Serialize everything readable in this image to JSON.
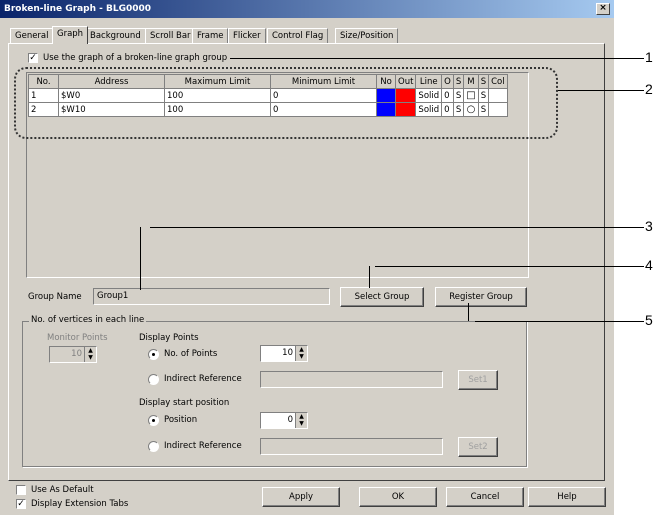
{
  "window": {
    "title": "Broken-line Graph - BLG0000",
    "close_glyph": "×"
  },
  "tabs": [
    {
      "label": "General"
    },
    {
      "label": "Graph"
    },
    {
      "label": "Background"
    },
    {
      "label": "Scroll Bar"
    },
    {
      "label": "Frame"
    },
    {
      "label": "Flicker"
    },
    {
      "label": "Control Flag"
    },
    {
      "label": "Size/Position"
    }
  ],
  "use_graph": {
    "label": "Use the graph of a broken-line graph group",
    "checked": true
  },
  "table": {
    "headers": [
      "No.",
      "Address",
      "Maximum Limit",
      "Minimum Limit",
      "No",
      "Out",
      "Line",
      "O",
      "S",
      "M",
      "S",
      "Col"
    ],
    "rows": [
      {
        "no": "1",
        "address": "$W0",
        "max": "100",
        "min": "0",
        "line": "Solid",
        "o": "0",
        "s": "S",
        "m": "□",
        "s2": "S",
        "normal_color": "#0000ff",
        "out_color": "#ff0000"
      },
      {
        "no": "2",
        "address": "$W10",
        "max": "100",
        "min": "0",
        "line": "Solid",
        "o": "0",
        "s": "S",
        "m": "○",
        "s2": "S",
        "normal_color": "#0000ff",
        "out_color": "#ff0000"
      }
    ]
  },
  "group_name": {
    "label": "Group Name",
    "value": "Group1"
  },
  "buttons": {
    "select_group": "Select Group",
    "register_group": "Register Group",
    "set1": "Set1",
    "set2": "Set2",
    "apply": "Apply",
    "ok": "OK",
    "cancel": "Cancel",
    "help": "Help"
  },
  "vertices": {
    "title": "No. of vertices in each line",
    "monitor_points_label": "Monitor Points",
    "monitor_points_value": "10",
    "display_points_label": "Display Points",
    "no_of_points_label": "No. of Points",
    "no_of_points_value": "10",
    "indirect_reference_label": "Indirect Reference",
    "display_start_label": "Display start position",
    "position_label": "Position",
    "position_value": "0",
    "indirect_reference2_label": "Indirect Reference"
  },
  "footer": {
    "use_as_default": "Use As Default",
    "display_extension_tabs": "Display Extension Tabs"
  },
  "callouts": [
    "1",
    "2",
    "3",
    "4",
    "5"
  ]
}
